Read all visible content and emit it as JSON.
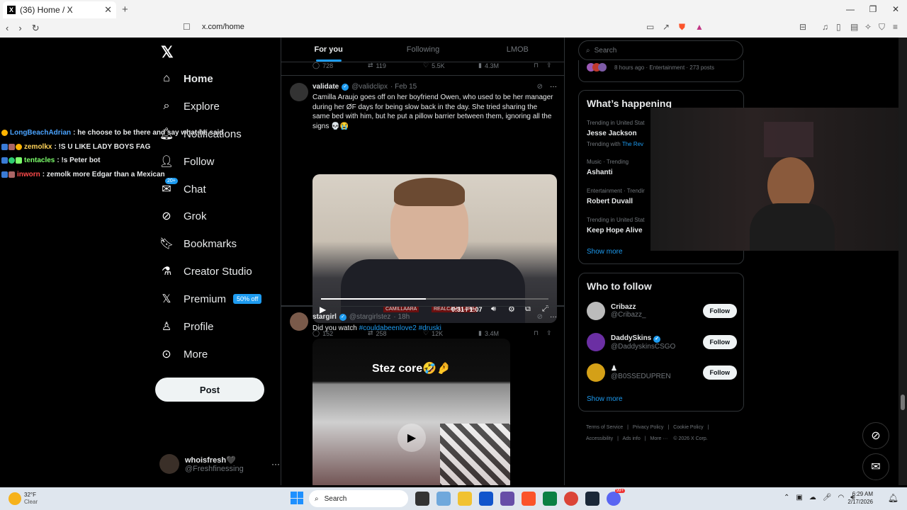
{
  "browser": {
    "tab_title": "(36) Home / X",
    "url": "x.com/home"
  },
  "sidebar": {
    "items": [
      {
        "label": "Home",
        "icon": "home-icon"
      },
      {
        "label": "Explore",
        "icon": "search-icon"
      },
      {
        "label": "Notifications",
        "icon": "bell-icon",
        "badge": "7"
      },
      {
        "label": "Follow",
        "icon": "add-user-icon"
      },
      {
        "label": "Chat",
        "icon": "mail-icon",
        "badge": "20+"
      },
      {
        "label": "Grok",
        "icon": "grok-icon"
      },
      {
        "label": "Bookmarks",
        "icon": "bookmark-icon"
      },
      {
        "label": "Creator Studio",
        "icon": "flask-icon"
      },
      {
        "label": "Premium",
        "icon": "x-icon"
      },
      {
        "label": "Profile",
        "icon": "person-icon"
      },
      {
        "label": "More",
        "icon": "more-circle-icon"
      }
    ],
    "premium_badge": "50% off",
    "post_button": "Post",
    "account": {
      "name": "whoisfresh🖤",
      "handle": "@Freshfinessing"
    }
  },
  "chat_overlay": [
    {
      "user": "LongBeachAdrian",
      "color": "#4aa3ff",
      "message": ": he choose to be there and say what he said"
    },
    {
      "user": "zemolkx",
      "color": "#ffd35a",
      "message": ": !S U LIKE LADY BOYS FAG"
    },
    {
      "user": "tentacles",
      "color": "#7cff6b",
      "message": ": !s Peter bot"
    },
    {
      "user": "inworn",
      "color": "#ff4b4b",
      "message": ": zemolk more Edgar than a Mexican"
    }
  ],
  "feed": {
    "tabs": [
      "For you",
      "Following",
      "LMOB"
    ],
    "prev_stats": {
      "replies": "728",
      "reposts": "119",
      "likes": "5.5K",
      "views": "4.3M"
    },
    "tweets": [
      {
        "name": "validate",
        "handle": "@validclipx",
        "time": "· Feb 15",
        "text": "Camilla Araujo goes off on her boyfriend Owen, who used to be her manager during her ØF days for being slow back in the day. She tried sharing the same bed with him, but he put a pillow barrier between them, ignoring all the signs 💀😭",
        "video_time": "0:31 / 1:07",
        "watermark": "CAMILLAARA",
        "watermark2": "REALCAMILLARA",
        "stats": {
          "replies": "152",
          "reposts": "258",
          "likes": "12K",
          "views": "3.4M"
        }
      },
      {
        "name": "stargirl",
        "handle": "@stargirlstez",
        "time": "· 18h",
        "text_plain": "Did you watch ",
        "hashtags": [
          "#couldabeenlove2",
          "#druski"
        ],
        "video_caption": "Stez core🤣🤌"
      }
    ]
  },
  "right": {
    "search_placeholder": "Search",
    "top_meta": "8 hours ago · Entertainment · 273 posts",
    "happening_title": "What’s happening",
    "trends": [
      {
        "meta": "Trending in United Stat",
        "name": "Jesse Jackson",
        "extra_prefix": "Trending with ",
        "extra_link": "The Rev"
      },
      {
        "meta": "Music · Trending",
        "name": "Ashanti"
      },
      {
        "meta": "Entertainment · Trendir",
        "name": "Robert Duvall"
      },
      {
        "meta": "Trending in United Stat",
        "name": "Keep Hope Alive"
      }
    ],
    "show_more": "Show more",
    "wtf_title": "Who to follow",
    "who_to_follow": [
      {
        "name": "Cribazz",
        "handle": "@Cribazz_",
        "button": "Follow"
      },
      {
        "name": "DaddySkins",
        "handle": "@DaddyskinsCSGO",
        "button": "Follow"
      },
      {
        "name": "♟",
        "handle": "@B0SSEDUPREN",
        "button": "Follow"
      }
    ],
    "footer": [
      "Terms of Service",
      "|",
      "Privacy Policy",
      "|",
      "Cookie Policy",
      "|",
      "Accessibility",
      "|",
      "Ads info",
      "|",
      "More ···",
      "© 2026 X Corp."
    ]
  },
  "taskbar": {
    "weather_temp": "32°F",
    "weather_desc": "Clear",
    "search": "Search",
    "time": "6:29 AM",
    "date": "2/17/2026",
    "notif": "99+"
  }
}
